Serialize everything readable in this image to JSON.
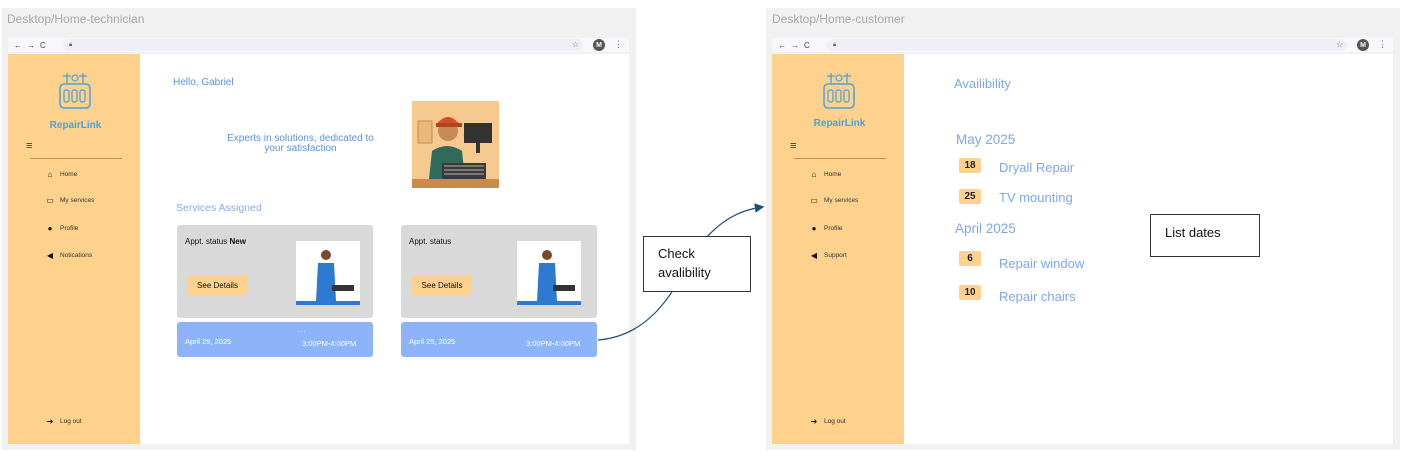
{
  "left_frame": {
    "label": "Desktop/Home-technician",
    "sidebar": {
      "brand": "RepairLink",
      "items": [
        {
          "label": "Home",
          "icon": "home-icon"
        },
        {
          "label": "My services",
          "icon": "folder-icon"
        },
        {
          "label": "Profile",
          "icon": "user-icon"
        },
        {
          "label": "Notications",
          "icon": "megaphone-icon"
        }
      ],
      "logout": "Log out"
    },
    "greeting": "Hello, Gabriel",
    "tagline_line1": "Experts in solutions, dedicated to",
    "tagline_line2": "your satisfaction",
    "section_title": "Services Assigned",
    "cards": [
      {
        "status_prefix": "Appt. status",
        "status_value": "New",
        "button": "See Details",
        "date": "April 29, 2025",
        "time": "3:00PM-4:00PM",
        "dots": "..."
      },
      {
        "status_prefix": "Appt. status",
        "status_value": "",
        "button": "See Details",
        "date": "April 25, 2025",
        "time": "3:00PM-4:00PM"
      }
    ]
  },
  "callout_check": {
    "line1": "Check",
    "line2": "avalibility"
  },
  "right_frame": {
    "label": "Desktop/Home-customer",
    "sidebar": {
      "brand": "RepairLink",
      "items": [
        {
          "label": "Home",
          "icon": "home-icon"
        },
        {
          "label": "My services",
          "icon": "folder-icon"
        },
        {
          "label": "Profile",
          "icon": "user-icon"
        },
        {
          "label": "Support",
          "icon": "megaphone-icon"
        }
      ],
      "logout": "Log out"
    },
    "title": "Availibility",
    "months": [
      {
        "name": "May 2025",
        "entries": [
          {
            "day": "18",
            "service": "Dryall Repair"
          },
          {
            "day": "25",
            "service": "TV mounting"
          }
        ]
      },
      {
        "name": "April 2025",
        "entries": [
          {
            "day": "6",
            "service": "Repair window"
          },
          {
            "day": "10",
            "service": "Repair chairs"
          }
        ]
      }
    ]
  },
  "callout_list": {
    "text": "List dates"
  },
  "browser": {
    "avatar_letter": "M"
  },
  "colors": {
    "sidebar": "#fed18c",
    "card_grey": "#d9d9d9",
    "card_blue": "#8db4f8",
    "accent_text": "#7fa6e8",
    "arrow": "#1f4e79"
  }
}
